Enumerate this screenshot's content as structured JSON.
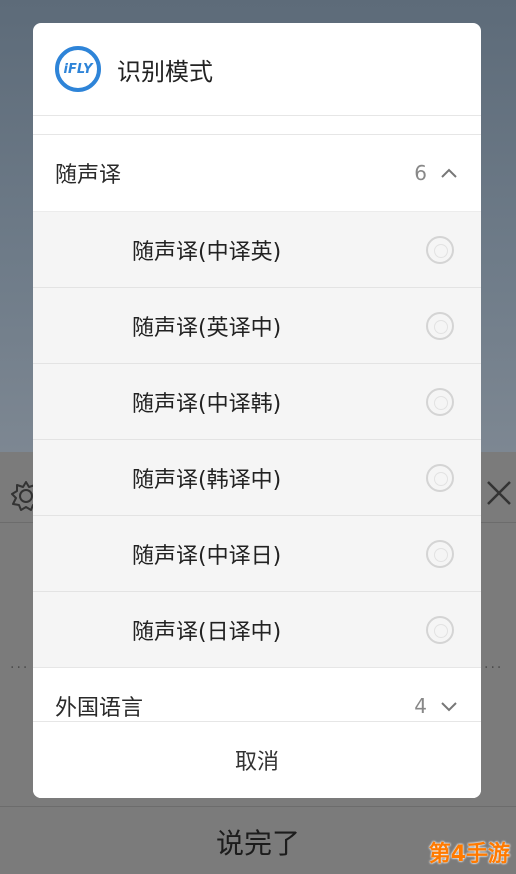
{
  "background": {
    "done_button_label": "说完了",
    "watermark": "第4手游"
  },
  "dialog": {
    "logo_text": "iFLY",
    "title": "识别模式",
    "groups": [
      {
        "label": "随声译",
        "count": "6",
        "expanded": true,
        "items": [
          {
            "label": "随声译(中译英)",
            "selected": false
          },
          {
            "label": "随声译(英译中)",
            "selected": false
          },
          {
            "label": "随声译(中译韩)",
            "selected": false
          },
          {
            "label": "随声译(韩译中)",
            "selected": false
          },
          {
            "label": "随声译(中译日)",
            "selected": false
          },
          {
            "label": "随声译(日译中)",
            "selected": false
          }
        ]
      },
      {
        "label": "外国语言",
        "count": "4",
        "expanded": false
      }
    ],
    "cancel_label": "取消"
  },
  "colors": {
    "brand": "#2e84d8",
    "watermark": "#ff7a00"
  }
}
